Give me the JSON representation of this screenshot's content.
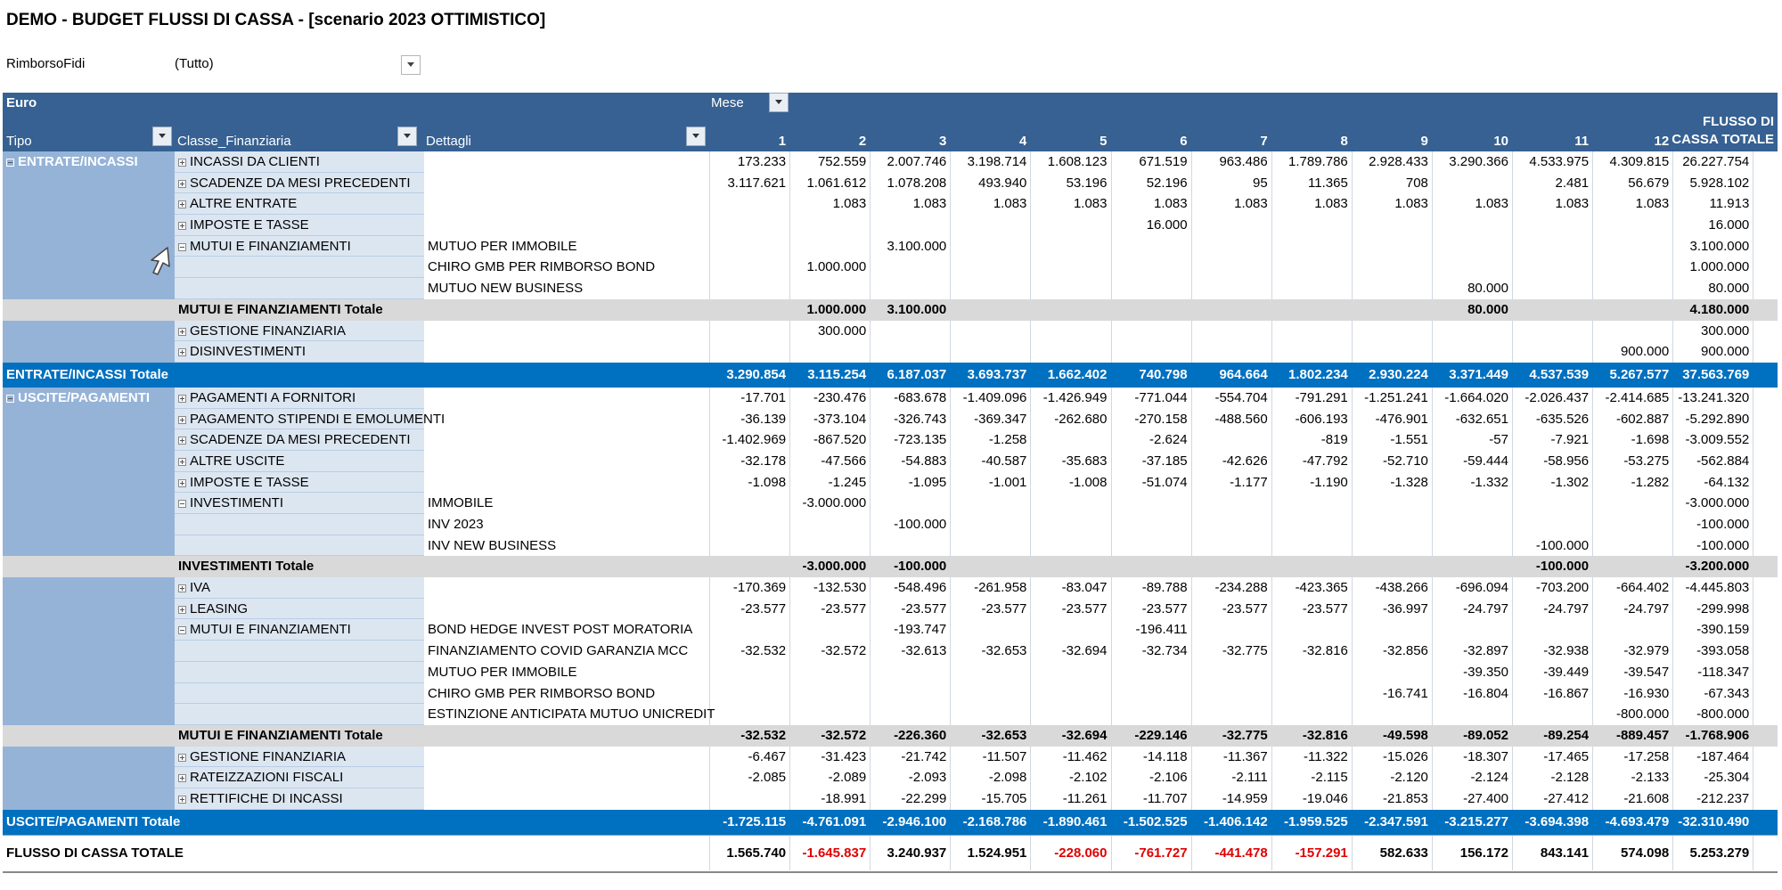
{
  "title": "DEMO - BUDGET FLUSSI DI CASSA - [scenario 2023 OTTIMISTICO]",
  "filter": {
    "label": "RimborsoFidi",
    "value": "(Tutto)"
  },
  "header": {
    "euro": "Euro",
    "mese": "Mese",
    "tipo": "Tipo",
    "classe": "Classe_Finanziaria",
    "dettagli": "Dettagli",
    "months": [
      "1",
      "2",
      "3",
      "4",
      "5",
      "6",
      "7",
      "8",
      "9",
      "10",
      "11",
      "12"
    ],
    "flusso_line1": "FLUSSO DI",
    "flusso_line2": "CASSA TOTALE"
  },
  "sections": [
    {
      "tipo": "ENTRATE/INCASSI",
      "rows": [
        {
          "kind": "c",
          "classe": "INCASSI DA CLIENTI",
          "expand": "plus",
          "det": "",
          "v": [
            "173.233",
            "752.559",
            "2.007.746",
            "3.198.714",
            "1.608.123",
            "671.519",
            "963.486",
            "1.789.786",
            "2.928.433",
            "3.290.366",
            "4.533.975",
            "4.309.815",
            "26.227.754"
          ]
        },
        {
          "kind": "c",
          "classe": "SCADENZE DA MESI PRECEDENTI",
          "expand": "plus",
          "det": "",
          "v": [
            "3.117.621",
            "1.061.612",
            "1.078.208",
            "493.940",
            "53.196",
            "52.196",
            "95",
            "11.365",
            "708",
            "",
            "2.481",
            "56.679",
            "5.928.102"
          ]
        },
        {
          "kind": "c",
          "classe": "ALTRE ENTRATE",
          "expand": "plus",
          "det": "",
          "v": [
            "",
            "1.083",
            "1.083",
            "1.083",
            "1.083",
            "1.083",
            "1.083",
            "1.083",
            "1.083",
            "1.083",
            "1.083",
            "1.083",
            "11.913"
          ]
        },
        {
          "kind": "c",
          "classe": "IMPOSTE E TASSE",
          "expand": "plus",
          "det": "",
          "v": [
            "",
            "",
            "",
            "",
            "",
            "16.000",
            "",
            "",
            "",
            "",
            "",
            "",
            "16.000"
          ]
        },
        {
          "kind": "c",
          "classe": "MUTUI E FINANZIAMENTI",
          "expand": "minus",
          "det": "MUTUO PER IMMOBILE",
          "v": [
            "",
            "",
            "3.100.000",
            "",
            "",
            "",
            "",
            "",
            "",
            "",
            "",
            "",
            "3.100.000"
          ]
        },
        {
          "kind": "d",
          "classe": "",
          "expand": "",
          "det": "CHIRO GMB PER RIMBORSO BOND",
          "v": [
            "",
            "1.000.000",
            "",
            "",
            "",
            "",
            "",
            "",
            "",
            "",
            "",
            "",
            "1.000.000"
          ]
        },
        {
          "kind": "d",
          "classe": "",
          "expand": "",
          "det": "MUTUO NEW BUSINESS",
          "v": [
            "",
            "",
            "",
            "",
            "",
            "",
            "",
            "",
            "",
            "80.000",
            "",
            "",
            "80.000"
          ]
        },
        {
          "kind": "s",
          "classe": "MUTUI E FINANZIAMENTI Totale",
          "expand": "",
          "det": "",
          "v": [
            "",
            "1.000.000",
            "3.100.000",
            "",
            "",
            "",
            "",
            "",
            "",
            "80.000",
            "",
            "",
            "4.180.000"
          ]
        },
        {
          "kind": "c",
          "classe": "GESTIONE FINANZIARIA",
          "expand": "plus",
          "det": "",
          "v": [
            "",
            "300.000",
            "",
            "",
            "",
            "",
            "",
            "",
            "",
            "",
            "",
            "",
            "300.000"
          ]
        },
        {
          "kind": "c",
          "classe": "DISINVESTIMENTI",
          "expand": "plus",
          "det": "",
          "v": [
            "",
            "",
            "",
            "",
            "",
            "",
            "",
            "",
            "",
            "",
            "",
            "900.000",
            "900.000"
          ]
        }
      ],
      "total_label": "ENTRATE/INCASSI Totale",
      "total": [
        "3.290.854",
        "3.115.254",
        "6.187.037",
        "3.693.737",
        "1.662.402",
        "740.798",
        "964.664",
        "1.802.234",
        "2.930.224",
        "3.371.449",
        "4.537.539",
        "5.267.577",
        "37.563.769"
      ]
    },
    {
      "tipo": "USCITE/PAGAMENTI",
      "rows": [
        {
          "kind": "c",
          "classe": "PAGAMENTI A FORNITORI",
          "expand": "plus",
          "det": "",
          "v": [
            "-17.701",
            "-230.476",
            "-683.678",
            "-1.409.096",
            "-1.426.949",
            "-771.044",
            "-554.704",
            "-791.291",
            "-1.251.241",
            "-1.664.020",
            "-2.026.437",
            "-2.414.685",
            "-13.241.320"
          ]
        },
        {
          "kind": "c",
          "classe": "PAGAMENTO STIPENDI E EMOLUMENTI",
          "expand": "plus",
          "det": "",
          "v": [
            "-36.139",
            "-373.104",
            "-326.743",
            "-369.347",
            "-262.680",
            "-270.158",
            "-488.560",
            "-606.193",
            "-476.901",
            "-632.651",
            "-635.526",
            "-602.887",
            "-5.292.890"
          ]
        },
        {
          "kind": "c",
          "classe": "SCADENZE DA MESI PRECEDENTI",
          "expand": "plus",
          "det": "",
          "v": [
            "-1.402.969",
            "-867.520",
            "-723.135",
            "-1.258",
            "",
            "-2.624",
            "",
            "-819",
            "-1.551",
            "-57",
            "-7.921",
            "-1.698",
            "-3.009.552"
          ]
        },
        {
          "kind": "c",
          "classe": "ALTRE USCITE",
          "expand": "plus",
          "det": "",
          "v": [
            "-32.178",
            "-47.566",
            "-54.883",
            "-40.587",
            "-35.683",
            "-37.185",
            "-42.626",
            "-47.792",
            "-52.710",
            "-59.444",
            "-58.956",
            "-53.275",
            "-562.884"
          ]
        },
        {
          "kind": "c",
          "classe": "IMPOSTE E TASSE",
          "expand": "plus",
          "det": "",
          "v": [
            "-1.098",
            "-1.245",
            "-1.095",
            "-1.001",
            "-1.008",
            "-51.074",
            "-1.177",
            "-1.190",
            "-1.328",
            "-1.332",
            "-1.302",
            "-1.282",
            "-64.132"
          ]
        },
        {
          "kind": "c",
          "classe": "INVESTIMENTI",
          "expand": "minus",
          "det": "IMMOBILE",
          "v": [
            "",
            "-3.000.000",
            "",
            "",
            "",
            "",
            "",
            "",
            "",
            "",
            "",
            "",
            "-3.000.000"
          ]
        },
        {
          "kind": "d",
          "classe": "",
          "expand": "",
          "det": "INV 2023",
          "v": [
            "",
            "",
            "-100.000",
            "",
            "",
            "",
            "",
            "",
            "",
            "",
            "",
            "",
            "-100.000"
          ]
        },
        {
          "kind": "d",
          "classe": "",
          "expand": "",
          "det": "INV NEW BUSINESS",
          "v": [
            "",
            "",
            "",
            "",
            "",
            "",
            "",
            "",
            "",
            "",
            "-100.000",
            "",
            "-100.000"
          ]
        },
        {
          "kind": "s",
          "classe": "INVESTIMENTI Totale",
          "expand": "",
          "det": "",
          "v": [
            "",
            "-3.000.000",
            "-100.000",
            "",
            "",
            "",
            "",
            "",
            "",
            "",
            "-100.000",
            "",
            "-3.200.000"
          ]
        },
        {
          "kind": "c",
          "classe": "IVA",
          "expand": "plus",
          "det": "",
          "v": [
            "-170.369",
            "-132.530",
            "-548.496",
            "-261.958",
            "-83.047",
            "-89.788",
            "-234.288",
            "-423.365",
            "-438.266",
            "-696.094",
            "-703.200",
            "-664.402",
            "-4.445.803"
          ]
        },
        {
          "kind": "c",
          "classe": "LEASING",
          "expand": "plus",
          "det": "",
          "v": [
            "-23.577",
            "-23.577",
            "-23.577",
            "-23.577",
            "-23.577",
            "-23.577",
            "-23.577",
            "-23.577",
            "-36.997",
            "-24.797",
            "-24.797",
            "-24.797",
            "-299.998"
          ]
        },
        {
          "kind": "c",
          "classe": "MUTUI E FINANZIAMENTI",
          "expand": "minus",
          "det": "BOND HEDGE INVEST POST MORATORIA",
          "v": [
            "",
            "",
            "-193.747",
            "",
            "",
            "-196.411",
            "",
            "",
            "",
            "",
            "",
            "",
            "-390.159"
          ]
        },
        {
          "kind": "d",
          "classe": "",
          "expand": "",
          "det": "FINANZIAMENTO COVID GARANZIA MCC",
          "v": [
            "-32.532",
            "-32.572",
            "-32.613",
            "-32.653",
            "-32.694",
            "-32.734",
            "-32.775",
            "-32.816",
            "-32.856",
            "-32.897",
            "-32.938",
            "-32.979",
            "-393.058"
          ]
        },
        {
          "kind": "d",
          "classe": "",
          "expand": "",
          "det": "MUTUO PER IMMOBILE",
          "v": [
            "",
            "",
            "",
            "",
            "",
            "",
            "",
            "",
            "",
            "-39.350",
            "-39.449",
            "-39.547",
            "-118.347"
          ]
        },
        {
          "kind": "d",
          "classe": "",
          "expand": "",
          "det": "CHIRO GMB PER RIMBORSO BOND",
          "v": [
            "",
            "",
            "",
            "",
            "",
            "",
            "",
            "",
            "-16.741",
            "-16.804",
            "-16.867",
            "-16.930",
            "-67.343"
          ]
        },
        {
          "kind": "d",
          "classe": "",
          "expand": "",
          "det": "ESTINZIONE ANTICIPATA MUTUO UNICREDIT",
          "v": [
            "",
            "",
            "",
            "",
            "",
            "",
            "",
            "",
            "",
            "",
            "",
            "-800.000",
            "-800.000"
          ]
        },
        {
          "kind": "s",
          "classe": "MUTUI E FINANZIAMENTI Totale",
          "expand": "",
          "det": "",
          "v": [
            "-32.532",
            "-32.572",
            "-226.360",
            "-32.653",
            "-32.694",
            "-229.146",
            "-32.775",
            "-32.816",
            "-49.598",
            "-89.052",
            "-89.254",
            "-889.457",
            "-1.768.906"
          ]
        },
        {
          "kind": "c",
          "classe": "GESTIONE FINANZIARIA",
          "expand": "plus",
          "det": "",
          "v": [
            "-6.467",
            "-31.423",
            "-21.742",
            "-11.507",
            "-11.462",
            "-14.118",
            "-11.367",
            "-11.322",
            "-15.026",
            "-18.307",
            "-17.465",
            "-17.258",
            "-187.464"
          ]
        },
        {
          "kind": "c",
          "classe": "RATEIZZAZIONI FISCALI",
          "expand": "plus",
          "det": "",
          "v": [
            "-2.085",
            "-2.089",
            "-2.093",
            "-2.098",
            "-2.102",
            "-2.106",
            "-2.111",
            "-2.115",
            "-2.120",
            "-2.124",
            "-2.128",
            "-2.133",
            "-25.304"
          ]
        },
        {
          "kind": "c",
          "classe": "RETTIFICHE DI INCASSI",
          "expand": "plus",
          "det": "",
          "v": [
            "",
            "-18.991",
            "-22.299",
            "-15.705",
            "-11.261",
            "-11.707",
            "-14.959",
            "-19.046",
            "-21.853",
            "-27.400",
            "-27.412",
            "-21.608",
            "-212.237"
          ]
        }
      ],
      "total_label": "USCITE/PAGAMENTI Totale",
      "total": [
        "-1.725.115",
        "-4.761.091",
        "-2.946.100",
        "-2.168.786",
        "-1.890.461",
        "-1.502.525",
        "-1.406.142",
        "-1.959.525",
        "-2.347.591",
        "-3.215.277",
        "-3.694.398",
        "-4.693.479",
        "-32.310.490"
      ]
    }
  ],
  "grand": {
    "label": "FLUSSO DI CASSA TOTALE",
    "values": [
      "1.565.740",
      "-1.645.837",
      "3.240.937",
      "1.524.951",
      "-228.060",
      "-761.727",
      "-441.478",
      "-157.291",
      "582.633",
      "156.172",
      "843.141",
      "574.098",
      "5.253.279"
    ],
    "negative_color": "#e00000"
  },
  "colors": {
    "header": "#366192",
    "total_band": "#0070c0",
    "tipo_band": "#95b3d7",
    "classe_cell": "#dce6f1",
    "subtotal": "#d9d9d9"
  }
}
